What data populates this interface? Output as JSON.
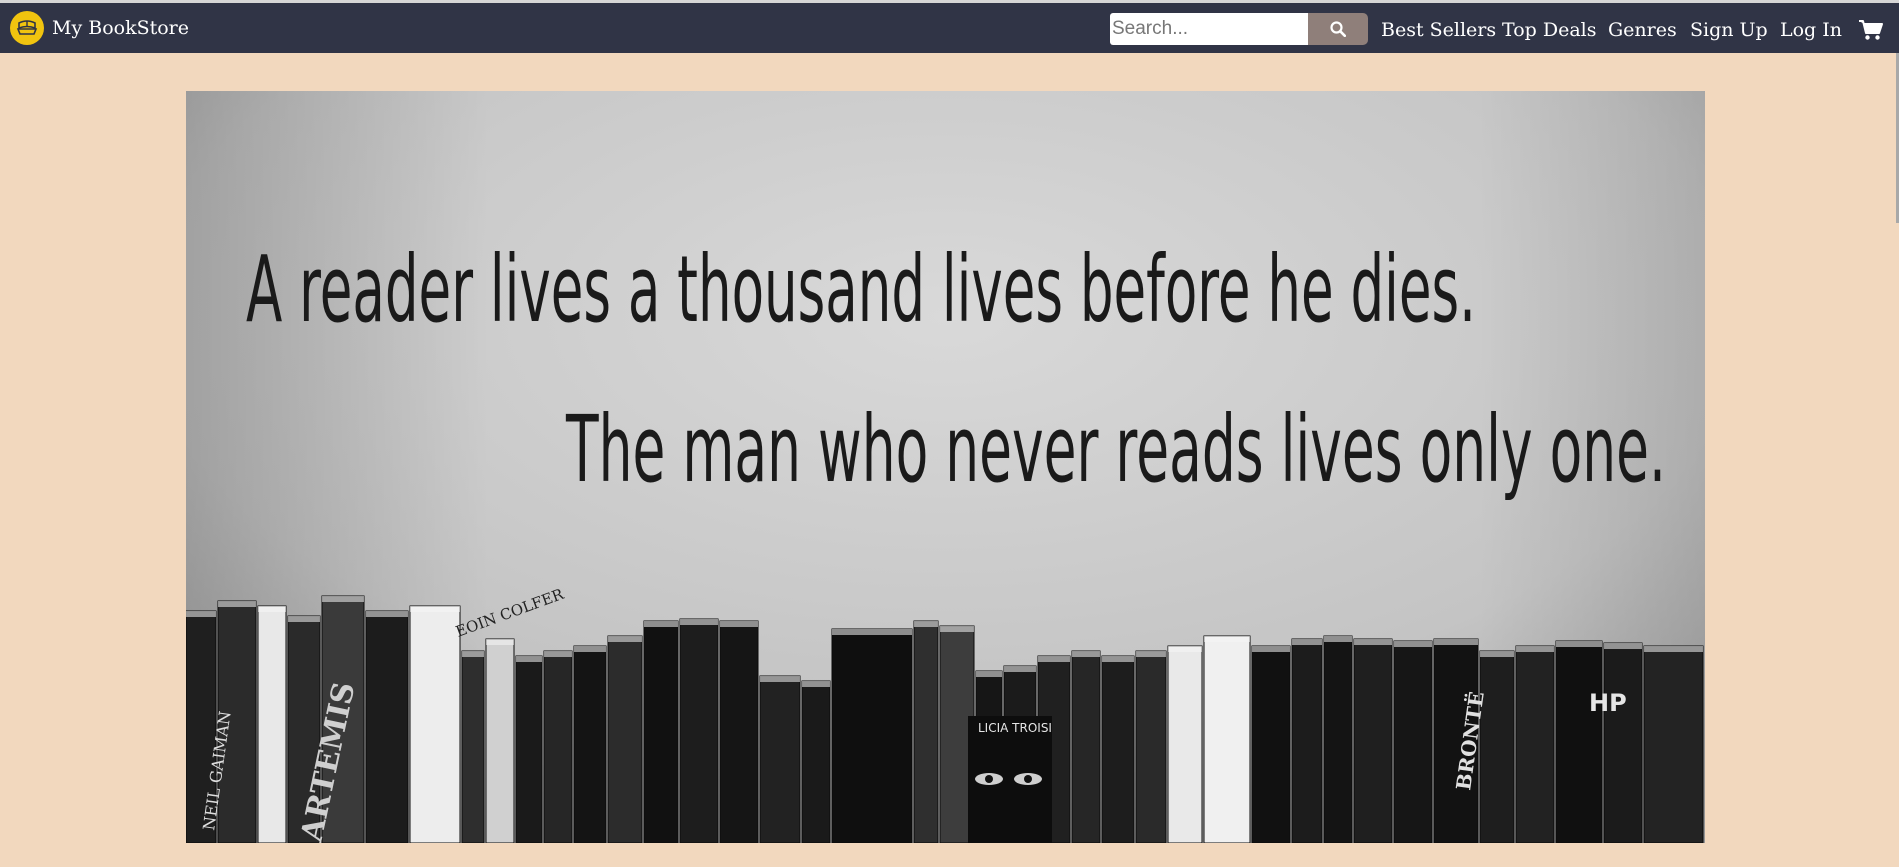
{
  "brand": {
    "name": "My BookStore",
    "logo_icon": "book-logo-icon"
  },
  "search": {
    "placeholder": "Search...",
    "value": "",
    "button_icon": "search-icon"
  },
  "nav": {
    "links": [
      "Best Sellers",
      "Top Deals",
      "Genres",
      "Sign Up",
      "Log In"
    ],
    "cart_icon": "cart-icon"
  },
  "hero": {
    "quote_line1": "A reader lives a thousand lives before he dies.",
    "quote_line2": "The man who never reads lives only one.",
    "spine_texts": [
      "NEIL GAIMAN",
      "ARTEMIS",
      "EOIN COLFER",
      "LICIA TROISI",
      "BRONTË",
      "HP"
    ]
  },
  "colors": {
    "navbar_bg": "#303446",
    "page_bg": "#f2d8be",
    "search_button": "#8f7f7a",
    "logo_yellow": "#f1c40f"
  }
}
